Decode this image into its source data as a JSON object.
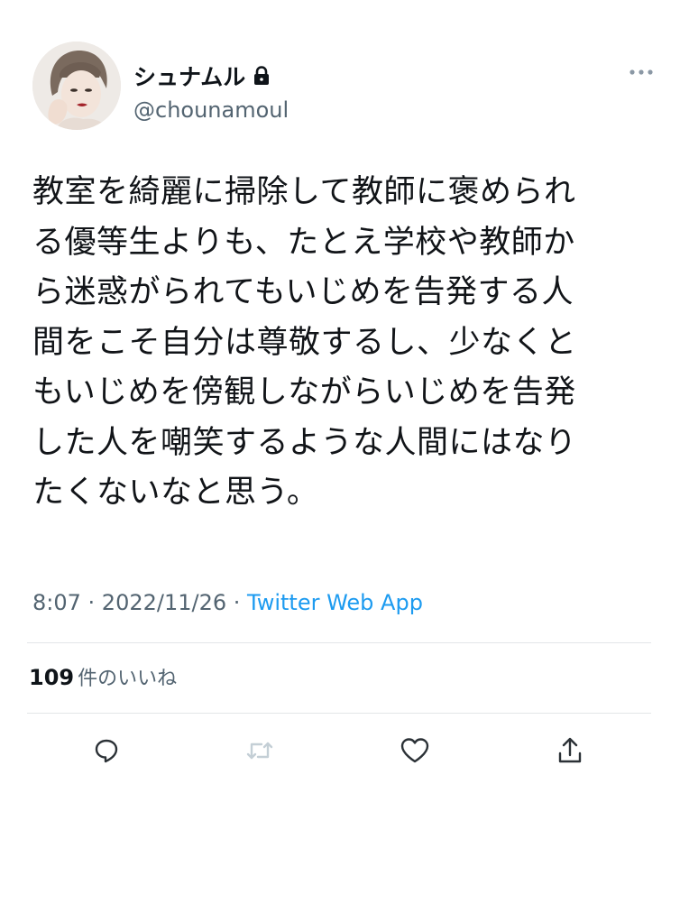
{
  "user": {
    "display_name": "シュナムル",
    "handle": "@chounamoul",
    "protected_icon": "lock-icon",
    "avatar": "avatar-illustration"
  },
  "tweet": {
    "lines": [
      "教室を綺麗に掃除して教師に褒められ",
      "る優等生よりも、たとえ学校や教師か",
      "ら迷惑がられてもいじめを告発する人",
      "間をこそ自分は尊敬するし、少なくと",
      "もいじめを傍観しながらいじめを告発",
      "した人を嘲笑するような人間にはなり",
      "たくないなと思う。"
    ],
    "time": "8:07",
    "date": "2022/11/26",
    "separator": " · ",
    "source": "Twitter Web App"
  },
  "stats": {
    "likes_count": "109",
    "likes_label": "件のいいね"
  },
  "actions": {
    "reply_icon": "reply-icon",
    "retweet_icon": "retweet-icon",
    "like_icon": "heart-icon",
    "share_icon": "share-icon"
  },
  "colors": {
    "text": "#0f1419",
    "secondary": "#536471",
    "link": "#1d9bf0",
    "divider": "#e3e6e8",
    "retweet_disabled": "#c4cfd6"
  }
}
